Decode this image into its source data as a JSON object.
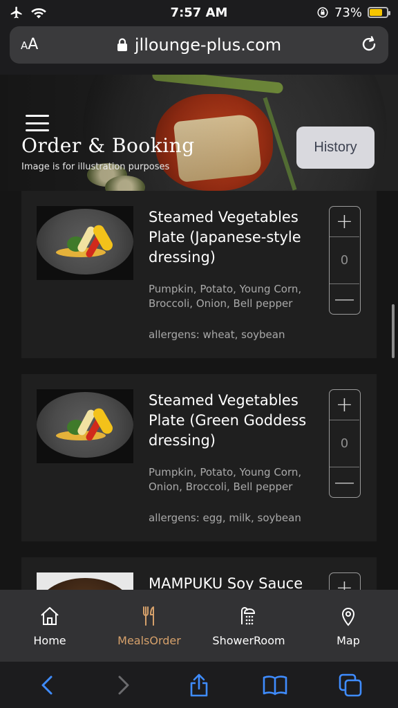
{
  "status_bar": {
    "time": "7:57 AM",
    "battery_percent": "73%",
    "battery_level": 0.73,
    "icons": [
      "airplane-icon",
      "wifi-icon",
      "rotation-lock-icon",
      "battery-icon"
    ]
  },
  "browser": {
    "text_size_label_small": "A",
    "text_size_label_large": "A",
    "url": "jllounge-plus.com",
    "icons": [
      "lock-icon",
      "reload-icon"
    ]
  },
  "header": {
    "title": "Order & Booking",
    "subtitle": "Image is for illustration purposes",
    "history_label": "History",
    "menu_icon": "hamburger-menu-icon"
  },
  "menu_items": [
    {
      "title": "Steamed Vegetables Plate (Japanese-style dressing)",
      "ingredients": "Pumpkin, Potato, Young Corn, Broccoli, Onion, Bell pepper",
      "allergens": "allergens: wheat,  soybean",
      "quantity": "0"
    },
    {
      "title": "Steamed Vegetables Plate (Green Goddess dressing)",
      "ingredients": "Pumpkin, Potato, Young Corn, Onion, Broccoli, Bell pepper",
      "allergens": "allergens: egg, milk, soybean",
      "quantity": "0"
    },
    {
      "title": "MAMPUKU Soy Sauce",
      "ingredients": "",
      "allergens": "",
      "quantity": ""
    }
  ],
  "stepper": {
    "plus": "+",
    "minus": "—"
  },
  "tabs": [
    {
      "label": "Home",
      "icon": "home-icon"
    },
    {
      "label": "MealsOrder",
      "icon": "fork-knife-icon"
    },
    {
      "label": "ShowerRoom",
      "icon": "shower-icon"
    },
    {
      "label": "Map",
      "icon": "map-pin-icon"
    }
  ],
  "colors": {
    "accent": "#d6a16b",
    "card_bg": "#1f1f1f",
    "history_button_bg": "#d9d9de",
    "safari_blue": "#3f8cff",
    "battery": "#f7c600"
  }
}
